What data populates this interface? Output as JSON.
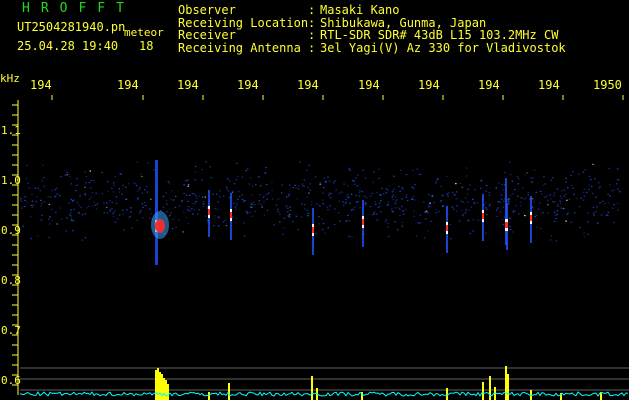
{
  "header": {
    "brand": "HROFFT",
    "filename": "UT2504281940.pn",
    "meteor_label": "meteor",
    "datetime": "25.04.28 19:40",
    "count": "18"
  },
  "meta": [
    {
      "key": "Observer",
      "value": "Masaki Kano"
    },
    {
      "key": "Receiving Location",
      "value": "Shibukawa, Gunma, Japan"
    },
    {
      "key": "Receiver",
      "value": "RTL-SDR SDR# 43dB L15 103.2MHz CW"
    },
    {
      "key": "Receiving Antenna",
      "value": "3el Yagi(V) Az 330 for Vladivostok"
    }
  ],
  "axis": {
    "x_ticks": [
      "194",
      "194",
      "194",
      "194",
      "194",
      "194",
      "194",
      "194",
      "194",
      "1950"
    ],
    "y_unit": "kHz",
    "y_ticks": [
      "1.1",
      "1.0",
      "0.9",
      "0.8",
      "0.7",
      "0.6"
    ]
  },
  "colors": {
    "text": "#ffff33",
    "brand": "#22d81f",
    "signal_strong": "#ff2a2a",
    "signal_mid": "#ffffff",
    "signal_weak": "#2255ff",
    "level_bar": "#ffff00",
    "noise_trace": "#00ffff"
  }
}
